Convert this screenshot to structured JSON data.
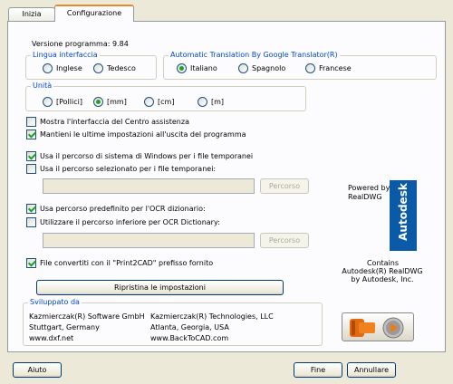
{
  "tabs": [
    {
      "label": "Inizia"
    },
    {
      "label": "Configurazione"
    }
  ],
  "version": "Versione programma: 9.84",
  "ui_language": {
    "title": "Lingua interfaccia",
    "options": [
      {
        "label": "Inglese",
        "selected": false
      },
      {
        "label": "Tedesco",
        "selected": false
      }
    ]
  },
  "translation": {
    "title": "Automatic Translation By Google Translator(R)",
    "options": [
      {
        "label": "Italiano",
        "selected": true
      },
      {
        "label": "Spagnolo",
        "selected": false
      },
      {
        "label": "Francese",
        "selected": false
      }
    ]
  },
  "units": {
    "title": "Unità",
    "options": [
      {
        "label": "[Pollici]",
        "selected": false
      },
      {
        "label": "[mm]",
        "selected": true
      },
      {
        "label": "[cm]",
        "selected": false
      },
      {
        "label": "[m]",
        "selected": false
      }
    ]
  },
  "checkboxes": {
    "help_center": {
      "label": "Mostra l'interfaccia del Centro assistenza",
      "checked": false
    },
    "keep_settings": {
      "label": "Mantieni le ultime impostazioni all'uscita del programma",
      "checked": true
    },
    "windows_temp": {
      "label": "Usa il percorso di sistema di Windows per i file temporanei",
      "checked": true
    },
    "custom_temp": {
      "label": "Usa il percorso selezionato per i file temporanei:",
      "checked": false
    },
    "ocr_default": {
      "label": "Usa percorso predefinito per l'OCR dizionario:",
      "checked": true
    },
    "ocr_custom": {
      "label": "Utilizzare il percorso inferiore per OCR Dictionary:",
      "checked": false
    },
    "print2cad": {
      "label": "File convertiti con il \"Print2CAD\" prefisso fornito",
      "checked": true
    }
  },
  "temp_path": {
    "value": "",
    "button": "Percorso"
  },
  "ocr_path": {
    "value": "",
    "button": "Percorso"
  },
  "reset_button": "Ripristina le impostazioni",
  "realdwg": {
    "powered": "Powered by",
    "realdwg": "RealDWG",
    "brand": "Autodesk",
    "contains": [
      "Contains",
      "Autodesk(R) RealDWG",
      "by Autodesk, Inc."
    ]
  },
  "developed": {
    "title": "Sviluppato da",
    "col1": [
      "Kazmierczak(R) Software GmbH",
      "Stuttgart, Germany",
      "www.dxf.net"
    ],
    "col2": [
      "Kazmierczak(R) Technologies, LLC",
      "Atlanta, Georgia, USA",
      "www.BackToCAD.com"
    ]
  },
  "footer": {
    "help": "Aiuto",
    "finish": "Fine",
    "cancel": "Annullare"
  },
  "colors": {
    "accent": "#0046d5",
    "tab_highlight": "#e68b2c",
    "autodesk_blue": "#0a5aa8"
  }
}
